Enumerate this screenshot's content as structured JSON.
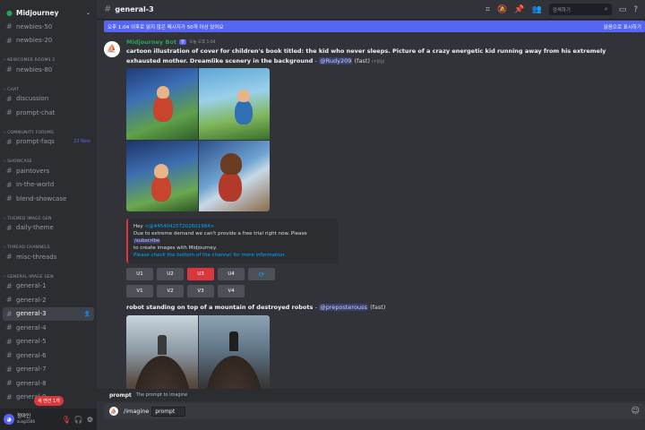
{
  "server": {
    "name": "Midjourney"
  },
  "sidebar": {
    "groups": [
      {
        "category": "",
        "channels": [
          {
            "name": "newbies-50"
          },
          {
            "name": "newbies-20"
          }
        ]
      },
      {
        "category": "NEWCOMER ROOMS 2",
        "channels": [
          {
            "name": "newbies-80"
          }
        ]
      },
      {
        "category": "CHAT",
        "channels": [
          {
            "name": "discussion"
          },
          {
            "name": "prompt-chat"
          }
        ]
      },
      {
        "category": "COMMUNITY FORUMS",
        "channels": [
          {
            "name": "prompt-faqs",
            "badge": "22 New"
          }
        ]
      },
      {
        "category": "SHOWCASE",
        "channels": [
          {
            "name": "paintovers"
          },
          {
            "name": "in-the-world"
          },
          {
            "name": "blend-showcase"
          }
        ]
      },
      {
        "category": "THEMED IMAGE GEN",
        "channels": [
          {
            "name": "daily-theme"
          }
        ]
      },
      {
        "category": "THREAD CHANNELS",
        "channels": [
          {
            "name": "misc-threads"
          }
        ]
      },
      {
        "category": "GENERAL IMAGE GEN",
        "channels": [
          {
            "name": "general-1"
          },
          {
            "name": "general-2"
          },
          {
            "name": "general-3",
            "active": true
          },
          {
            "name": "general-4"
          },
          {
            "name": "general-5"
          },
          {
            "name": "general-6"
          },
          {
            "name": "general-7"
          },
          {
            "name": "general-8"
          },
          {
            "name": "general-9"
          }
        ]
      }
    ]
  },
  "user": {
    "name": "정아인",
    "tag": "zung1506",
    "toast": "새 멘션 1개"
  },
  "topbar": {
    "channel": "general-3",
    "search_placeholder": "검색하기"
  },
  "banner": {
    "text": "오후 1:04 이후로 읽지 않은 메시지가 50개 이상 있어요",
    "mark_read": "읽음으로 표시하기"
  },
  "message1": {
    "author": "Midjourney Bot",
    "bot_tag": "봇",
    "time": "오늘 오후 1:04",
    "prompt": "cartoon illustration of cover for children's book titled: the kid who never sleeps. Picture of a crazy energetic kid running away from his extremely exhausted mother. Dreamlike scenery in the background",
    "separator": "-",
    "mention": "@Rudy209",
    "speed": "(fast)",
    "edited": "(수정됨)"
  },
  "embed": {
    "greeting": "Hey",
    "mention": "<@445404257202601984>",
    "line1": "Due to extreme demand we can't provide a free trial right now. Please",
    "link": "/subscribe",
    "line2": "to create images with Midjourney.",
    "line3": "Please check the bottom of the channel for more information."
  },
  "buttons": {
    "upscale": [
      "U1",
      "U2",
      "U3",
      "U4"
    ],
    "variation": [
      "V1",
      "V2",
      "V3",
      "V4"
    ],
    "reroll_icon": "refresh-icon",
    "selected": "U3"
  },
  "message2": {
    "prompt": "robot standing on top of a mountain of destroyed robots",
    "separator": "-",
    "mention": "@preposterouss",
    "speed": "(fast)"
  },
  "composer": {
    "hint_name": "prompt",
    "hint_desc": "The prompt to imagine",
    "command": "/imagine",
    "option": "prompt"
  },
  "colors": {
    "accent": "#5865f2",
    "danger": "#da373c",
    "bot_name": "#23a55a",
    "background": "#313338"
  }
}
